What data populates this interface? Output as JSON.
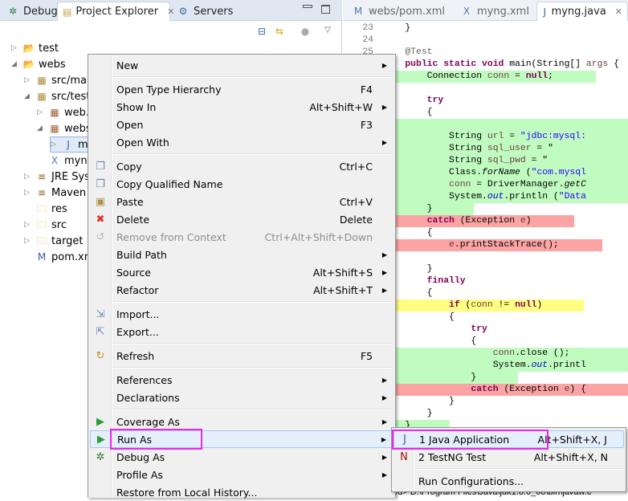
{
  "left_tabs": [
    {
      "label": "Debug",
      "icon": "bug-icon"
    },
    {
      "label": "Project Explorer",
      "icon": "project-explorer-icon",
      "active": true
    },
    {
      "label": "Servers",
      "icon": "servers-icon"
    }
  ],
  "tree": [
    {
      "label": "test",
      "level": 0,
      "expand": "collapsed",
      "icon": "java-project-icon"
    },
    {
      "label": "webs",
      "level": 0,
      "expand": "expanded",
      "icon": "maven-project-icon"
    },
    {
      "label": "src/main",
      "level": 1,
      "expand": "collapsed",
      "icon": "source-folder-icon"
    },
    {
      "label": "src/test/j",
      "level": 1,
      "expand": "expanded",
      "icon": "source-folder-icon"
    },
    {
      "label": "web.w",
      "level": 2,
      "expand": "collapsed",
      "icon": "package-icon"
    },
    {
      "label": "webs",
      "level": 2,
      "expand": "expanded",
      "icon": "package-icon"
    },
    {
      "label": "my",
      "level": 3,
      "expand": "collapsed",
      "icon": "java-file-icon",
      "selected": true
    },
    {
      "label": "myng.",
      "level": 2,
      "expand": "none",
      "icon": "xml-file-icon"
    },
    {
      "label": "JRE Syste",
      "level": 1,
      "expand": "collapsed",
      "icon": "library-icon"
    },
    {
      "label": "Maven D",
      "level": 1,
      "expand": "collapsed",
      "icon": "library-icon"
    },
    {
      "label": "res",
      "level": 1,
      "expand": "none",
      "icon": "folder-icon"
    },
    {
      "label": "src",
      "level": 1,
      "expand": "collapsed",
      "icon": "folder-icon"
    },
    {
      "label": "target",
      "level": 1,
      "expand": "collapsed",
      "icon": "folder-icon"
    },
    {
      "label": "pom.xml",
      "level": 1,
      "expand": "none",
      "icon": "maven-pom-icon"
    }
  ],
  "editor_tabs": [
    {
      "label": "webs/pom.xml",
      "icon": "maven-pom-icon"
    },
    {
      "label": "myng.xml",
      "icon": "xml-file-icon"
    },
    {
      "label": "myng.java",
      "icon": "java-file-icon",
      "active": true
    }
  ],
  "code": [
    {
      "n": "23",
      "hl": "",
      "t": [
        [
          "",
          "    }"
        ]
      ]
    },
    {
      "n": "24",
      "hl": "",
      "t": [
        [
          "",
          ""
        ]
      ]
    },
    {
      "n": "25",
      "hl": "",
      "t": [
        [
          "ann",
          "    @Test"
        ]
      ]
    },
    {
      "n": "",
      "hl": "",
      "t": [
        [
          "kw",
          "    public static void "
        ],
        [
          "",
          "main(String[] "
        ],
        [
          "var",
          "args"
        ],
        [
          "",
          " {"
        ]
      ]
    },
    {
      "n": "",
      "hl": "g",
      "t": [
        [
          "",
          "        Connection "
        ],
        [
          "var",
          "conn"
        ],
        [
          "",
          " = "
        ],
        [
          "kw",
          "null"
        ],
        [
          "",
          ";"
        ]
      ]
    },
    {
      "n": "",
      "hl": "",
      "t": [
        [
          "",
          ""
        ]
      ]
    },
    {
      "n": "",
      "hl": "",
      "t": [
        [
          "kw",
          "        try"
        ]
      ]
    },
    {
      "n": "",
      "hl": "",
      "t": [
        [
          "",
          "        {"
        ]
      ]
    },
    {
      "n": "",
      "hl": "g",
      "t": [
        [
          "",
          ""
        ]
      ]
    },
    {
      "n": "",
      "hl": "g",
      "t": [
        [
          "",
          "            String "
        ],
        [
          "var",
          "url"
        ],
        [
          "",
          " = "
        ],
        [
          "str",
          "\"jdbc:mysql:"
        ]
      ]
    },
    {
      "n": "",
      "hl": "g",
      "t": [
        [
          "",
          "            String "
        ],
        [
          "var",
          "sql_user"
        ],
        [
          "",
          " = \""
        ]
      ]
    },
    {
      "n": "",
      "hl": "g",
      "t": [
        [
          "",
          "            String "
        ],
        [
          "var",
          "sql_pwd"
        ],
        [
          "",
          " = \""
        ]
      ]
    },
    {
      "n": "",
      "hl": "g",
      "t": [
        [
          "",
          "            Class."
        ],
        [
          "it",
          "forName"
        ],
        [
          "",
          " ("
        ],
        [
          "str",
          "\"com.mysql"
        ]
      ]
    },
    {
      "n": "",
      "hl": "g",
      "t": [
        [
          "var",
          "            conn"
        ],
        [
          "",
          " = DriverManager."
        ],
        [
          "it",
          "getC"
        ]
      ]
    },
    {
      "n": "",
      "hl": "g",
      "t": [
        [
          "",
          "            System."
        ],
        [
          "fld",
          "out"
        ],
        [
          "",
          ".println ("
        ],
        [
          "str",
          "\"Data"
        ]
      ]
    },
    {
      "n": "",
      "hl": "g",
      "t": [
        [
          "",
          "        }"
        ]
      ]
    },
    {
      "n": "",
      "hl": "r",
      "t": [
        [
          "kw",
          "        catch"
        ],
        [
          "",
          " (Exception "
        ],
        [
          "var",
          "e"
        ],
        [
          "",
          ")"
        ]
      ]
    },
    {
      "n": "",
      "hl": "",
      "t": [
        [
          "",
          "        {"
        ]
      ]
    },
    {
      "n": "",
      "hl": "r",
      "t": [
        [
          "var",
          "            e"
        ],
        [
          "",
          ".printStackTrace();"
        ]
      ]
    },
    {
      "n": "",
      "hl": "",
      "t": [
        [
          "",
          ""
        ]
      ]
    },
    {
      "n": "",
      "hl": "",
      "t": [
        [
          "",
          "        }"
        ]
      ]
    },
    {
      "n": "",
      "hl": "",
      "t": [
        [
          "kw",
          "        finally"
        ]
      ]
    },
    {
      "n": "",
      "hl": "",
      "t": [
        [
          "",
          "        {"
        ]
      ]
    },
    {
      "n": "",
      "hl": "y",
      "t": [
        [
          "kw",
          "            if"
        ],
        [
          "",
          " ("
        ],
        [
          "var",
          "conn"
        ],
        [
          "",
          " != "
        ],
        [
          "kw",
          "null"
        ],
        [
          "",
          ")"
        ]
      ]
    },
    {
      "n": "",
      "hl": "",
      "t": [
        [
          "",
          "            {"
        ]
      ]
    },
    {
      "n": "",
      "hl": "",
      "t": [
        [
          "kw",
          "                try"
        ]
      ]
    },
    {
      "n": "",
      "hl": "",
      "t": [
        [
          "",
          "                {"
        ]
      ]
    },
    {
      "n": "",
      "hl": "g",
      "t": [
        [
          "var",
          "                    conn"
        ],
        [
          "",
          ".close ();"
        ]
      ]
    },
    {
      "n": "",
      "hl": "g",
      "t": [
        [
          "",
          "                    System."
        ],
        [
          "fld",
          "out"
        ],
        [
          "",
          ".printl"
        ]
      ]
    },
    {
      "n": "",
      "hl": "g",
      "t": [
        [
          "",
          "                }"
        ]
      ]
    },
    {
      "n": "",
      "hl": "r",
      "t": [
        [
          "kw",
          "                catch"
        ],
        [
          "",
          " (Exception "
        ],
        [
          "var",
          "e"
        ],
        [
          "",
          ") {"
        ]
      ]
    },
    {
      "n": "",
      "hl": "",
      "t": [
        [
          "",
          "            }"
        ]
      ]
    },
    {
      "n": "",
      "hl": "",
      "t": [
        [
          "",
          "        }"
        ]
      ]
    },
    {
      "n": "",
      "hl": "g",
      "t": [
        [
          "",
          "    }"
        ]
      ]
    }
  ],
  "console_line": "ed> D:\\Program Files\\Java\\jdk1.8.0_60\\bin\\javaw.e",
  "context_menu": [
    {
      "label": "New",
      "sub": true
    },
    {
      "sep": true
    },
    {
      "label": "Open Type Hierarchy",
      "shortcut": "F4"
    },
    {
      "label": "Show In",
      "shortcut": "Alt+Shift+W",
      "sub": true
    },
    {
      "label": "Open",
      "shortcut": "F3"
    },
    {
      "label": "Open With",
      "sub": true
    },
    {
      "sep": true
    },
    {
      "label": "Copy",
      "shortcut": "Ctrl+C",
      "icon": "copy-icon"
    },
    {
      "label": "Copy Qualified Name",
      "icon": "copy-qualified-name-icon"
    },
    {
      "label": "Paste",
      "shortcut": "Ctrl+V",
      "icon": "paste-icon"
    },
    {
      "label": "Delete",
      "shortcut": "Delete",
      "icon": "delete-icon"
    },
    {
      "label": "Remove from Context",
      "shortcut": "Ctrl+Alt+Shift+Down",
      "icon": "remove-context-icon",
      "disabled": true
    },
    {
      "label": "Build Path",
      "sub": true
    },
    {
      "label": "Source",
      "shortcut": "Alt+Shift+S",
      "sub": true
    },
    {
      "label": "Refactor",
      "shortcut": "Alt+Shift+T",
      "sub": true
    },
    {
      "sep": true
    },
    {
      "label": "Import...",
      "icon": "import-icon"
    },
    {
      "label": "Export...",
      "icon": "export-icon"
    },
    {
      "sep": true
    },
    {
      "label": "Refresh",
      "shortcut": "F5",
      "icon": "refresh-icon"
    },
    {
      "sep": true
    },
    {
      "label": "References",
      "sub": true
    },
    {
      "label": "Declarations",
      "sub": true
    },
    {
      "sep": true
    },
    {
      "label": "Coverage As",
      "sub": true,
      "icon": "coverage-icon"
    },
    {
      "label": "Run As",
      "sub": true,
      "icon": "run-icon",
      "highlighted": true
    },
    {
      "label": "Debug As",
      "sub": true,
      "icon": "bug-icon"
    },
    {
      "label": "Profile As",
      "sub": true
    },
    {
      "label": "Restore from Local History..."
    }
  ],
  "run_as_submenu": [
    {
      "label": "1 Java Application",
      "shortcut": "Alt+Shift+X, J",
      "icon": "java-application-icon",
      "highlighted": true
    },
    {
      "label": "2 TestNG Test",
      "shortcut": "Alt+Shift+X, N",
      "icon": "testng-icon"
    },
    {
      "sep": true
    },
    {
      "label": "Run Configurations..."
    }
  ],
  "colors": {
    "highlight_box": "#f024e8",
    "coverage_green": "#c0fcc0",
    "coverage_red": "#fca4a4",
    "coverage_yellow": "#fefe82"
  }
}
